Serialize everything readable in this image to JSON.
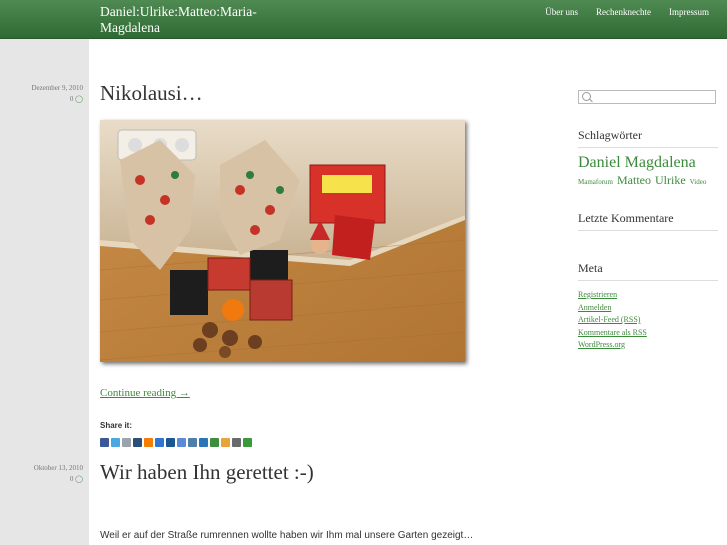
{
  "header": {
    "site_title": "Daniel:Ulrike:Matteo:Maria-Magdalena",
    "nav": [
      {
        "label": "Über uns"
      },
      {
        "label": "Rechenknechte"
      },
      {
        "label": "Impressum"
      }
    ]
  },
  "posts": [
    {
      "date": "Dezember 9, 2010",
      "comments": "0",
      "title": "Nikolausi…",
      "continue_label": "Continue reading →",
      "share_label": "Share it:"
    },
    {
      "date": "Oktober 13, 2010",
      "comments": "0",
      "title": "Wir haben Ihn gerettet :-)",
      "excerpt": "Weil er auf der Straße rumrennen wollte haben wir Ihm mal unsere Garten gezeigt…"
    }
  ],
  "share_icons": [
    {
      "name": "facebook-icon",
      "color": "#3b5998"
    },
    {
      "name": "twitter-icon",
      "color": "#4aa8e0"
    },
    {
      "name": "email-icon",
      "color": "#9aa4ad"
    },
    {
      "name": "myspace-icon",
      "color": "#2a4f7a"
    },
    {
      "name": "blogger-icon",
      "color": "#f57d00"
    },
    {
      "name": "delicious-icon",
      "color": "#3274d1"
    },
    {
      "name": "digg-icon",
      "color": "#1b5891"
    },
    {
      "name": "google-icon",
      "color": "#5a8bd8"
    },
    {
      "name": "google-buzz-icon",
      "color": "#4f7fa8"
    },
    {
      "name": "linkedin-icon",
      "color": "#2b75b6"
    },
    {
      "name": "live-icon",
      "color": "#3d8f3d"
    },
    {
      "name": "bookmark-icon",
      "color": "#e8a33a"
    },
    {
      "name": "print-icon",
      "color": "#6a6a6a"
    },
    {
      "name": "share-icon",
      "color": "#3a9a3a"
    }
  ],
  "sidebar": {
    "search_placeholder": "",
    "tags_title": "Schlagwörter",
    "tags": [
      {
        "label": "Daniel",
        "size": "large"
      },
      {
        "label": "Magdalena",
        "size": "large"
      },
      {
        "label": "Mamaforum",
        "size": "small"
      },
      {
        "label": "Matteo",
        "size": "medium"
      },
      {
        "label": "Ulrike",
        "size": "medium"
      },
      {
        "label": "Video",
        "size": "small"
      }
    ],
    "comments_title": "Letzte Kommentare",
    "meta_title": "Meta",
    "meta_links": [
      "Registrieren",
      "Anmelden",
      "Artikel-Feed (RSS)",
      "Kommentare als RSS",
      "WordPress.org"
    ]
  },
  "colors": {
    "header": "#3a753d",
    "link": "#3c8b3c",
    "left_column": "#e6e6e6"
  }
}
